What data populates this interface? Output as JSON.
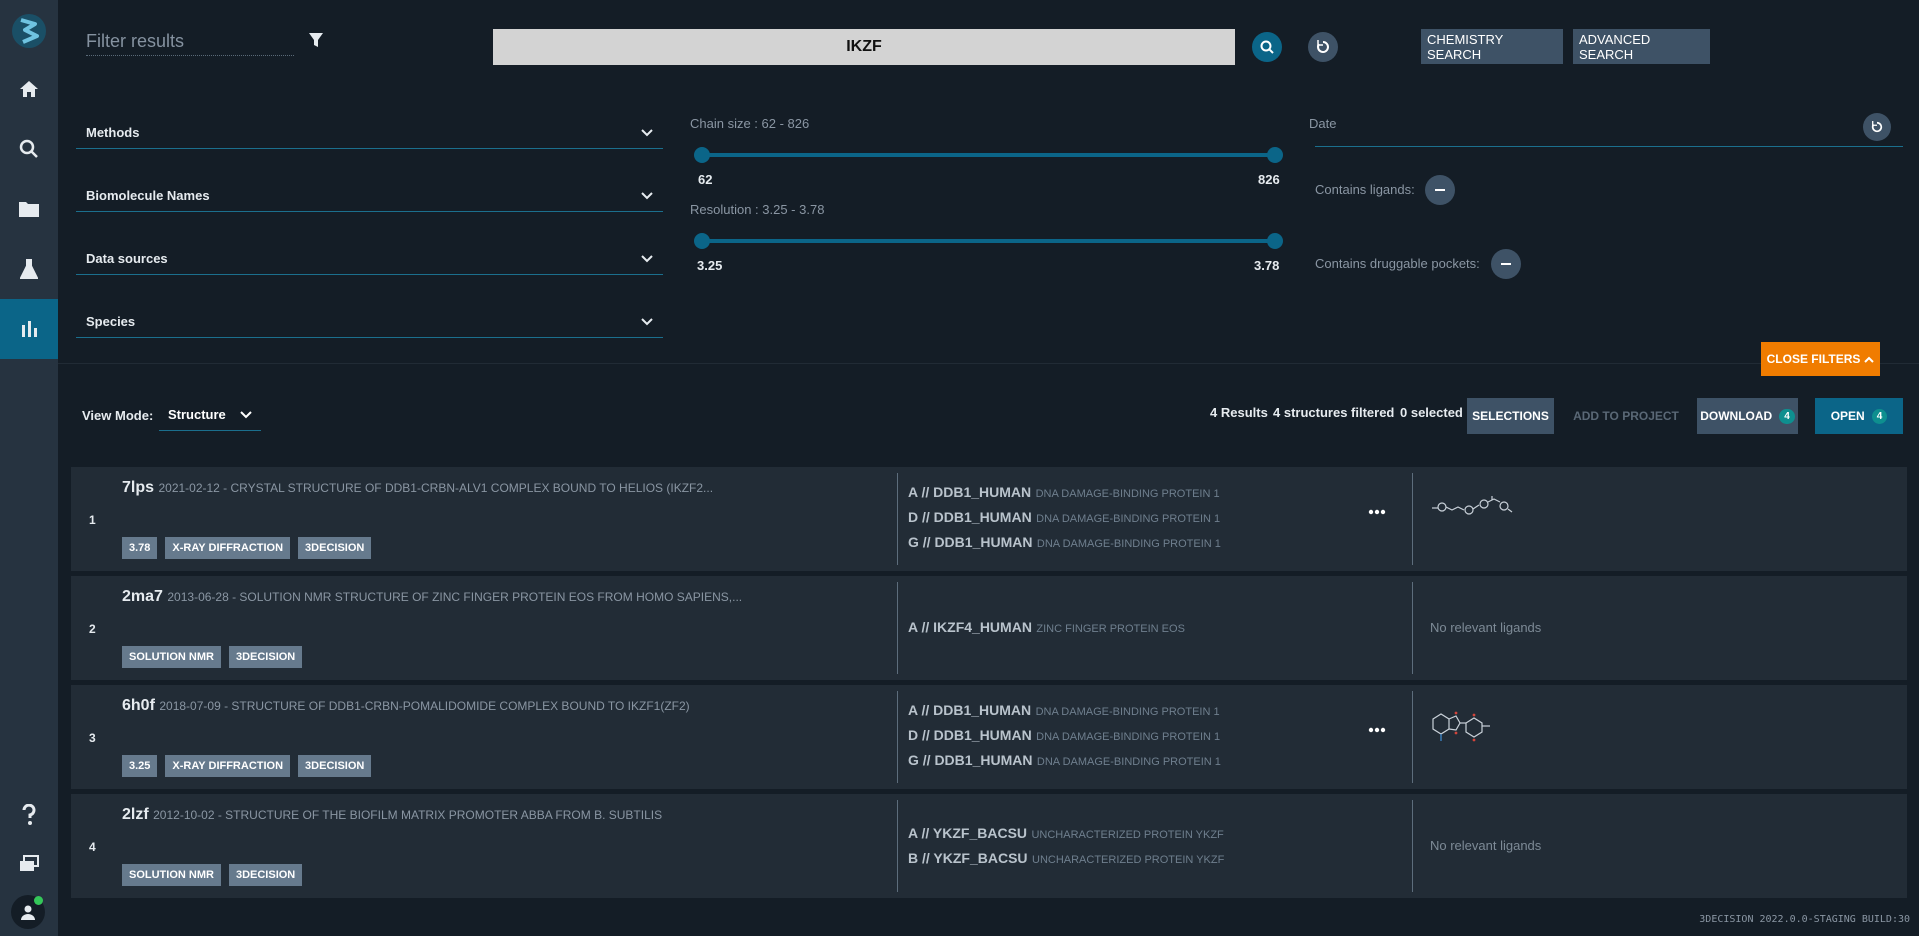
{
  "filter": {
    "placeholder": "Filter results"
  },
  "search": {
    "query": "IKZF",
    "chemistry_label": "CHEMISTRY SEARCH",
    "advanced_label": "ADVANCED SEARCH"
  },
  "filters": {
    "dropdowns": [
      {
        "label": "Methods"
      },
      {
        "label": "Biomolecule Names"
      },
      {
        "label": "Data sources"
      },
      {
        "label": "Species"
      }
    ],
    "chain_size": {
      "label": "Chain size : 62 - 826",
      "min": "62",
      "max": "826",
      "range_min": 62,
      "range_max": 826
    },
    "resolution": {
      "label": "Resolution : 3.25 - 3.78",
      "min": "3.25",
      "max": "3.78",
      "range_min": 3.25,
      "range_max": 3.78
    },
    "date_label": "Date",
    "contains_ligands_label": "Contains ligands:",
    "contains_pockets_label": "Contains druggable pockets:",
    "close_label": "CLOSE FILTERS"
  },
  "results_header": {
    "view_mode_label": "View Mode:",
    "view_mode_value": "Structure",
    "results_count": "4 Results",
    "filtered_count": "4 structures filtered",
    "selected_count": "0 selected",
    "selections_label": "SELECTIONS",
    "add_to_project_label": "ADD TO PROJECT",
    "download_label": "DOWNLOAD",
    "download_count": "4",
    "open_label": "OPEN",
    "open_count": "4"
  },
  "results": [
    {
      "index": "1",
      "pdb_id": "7lps",
      "description": "2021-02-12 - CRYSTAL STRUCTURE OF DDB1-CRBN-ALV1 COMPLEX BOUND TO HELIOS (IKZF2...",
      "tags": [
        "3.78",
        "X-RAY DIFFRACTION",
        "3DECISION"
      ],
      "chains": [
        {
          "id": "A // DDB1_HUMAN",
          "name": "DNA DAMAGE-BINDING PROTEIN 1"
        },
        {
          "id": "D // DDB1_HUMAN",
          "name": "DNA DAMAGE-BINDING PROTEIN 1"
        },
        {
          "id": "G // DDB1_HUMAN",
          "name": "DNA DAMAGE-BINDING PROTEIN 1"
        }
      ],
      "ligand_text": ""
    },
    {
      "index": "2",
      "pdb_id": "2ma7",
      "description": "2013-06-28 - SOLUTION NMR STRUCTURE OF ZINC FINGER PROTEIN EOS FROM HOMO SAPIENS,...",
      "tags": [
        "SOLUTION NMR",
        "3DECISION"
      ],
      "chains": [
        {
          "id": "A // IKZF4_HUMAN",
          "name": "ZINC FINGER PROTEIN EOS"
        }
      ],
      "ligand_text": "No relevant ligands"
    },
    {
      "index": "3",
      "pdb_id": "6h0f",
      "description": "2018-07-09 - STRUCTURE OF DDB1-CRBN-POMALIDOMIDE COMPLEX BOUND TO IKZF1(ZF2)",
      "tags": [
        "3.25",
        "X-RAY DIFFRACTION",
        "3DECISION"
      ],
      "chains": [
        {
          "id": "A // DDB1_HUMAN",
          "name": "DNA DAMAGE-BINDING PROTEIN 1"
        },
        {
          "id": "D // DDB1_HUMAN",
          "name": "DNA DAMAGE-BINDING PROTEIN 1"
        },
        {
          "id": "G // DDB1_HUMAN",
          "name": "DNA DAMAGE-BINDING PROTEIN 1"
        }
      ],
      "ligand_text": ""
    },
    {
      "index": "4",
      "pdb_id": "2lzf",
      "description": "2012-10-02 - STRUCTURE OF THE BIOFILM MATRIX PROMOTER ABBA FROM B. SUBTILIS",
      "tags": [
        "SOLUTION NMR",
        "3DECISION"
      ],
      "chains": [
        {
          "id": "A // YKZF_BACSU",
          "name": "UNCHARACTERIZED PROTEIN YKZF"
        },
        {
          "id": "B // YKZF_BACSU",
          "name": "UNCHARACTERIZED PROTEIN YKZF"
        }
      ],
      "ligand_text": "No relevant ligands"
    }
  ],
  "footer": "3DECISION 2022.0.0-STAGING BUILD:30",
  "colors": {
    "accent": "#0b6588",
    "orange": "#f07c00",
    "sidebar": "#263340",
    "background": "#141d26"
  },
  "icons": [
    "logo-icon",
    "home-icon",
    "search-icon",
    "folder-icon",
    "flask-icon",
    "bar-chart-icon",
    "help-icon",
    "layers-icon",
    "user-icon",
    "filter-icon",
    "refresh-icon",
    "chevron-down-icon",
    "more-icon"
  ]
}
